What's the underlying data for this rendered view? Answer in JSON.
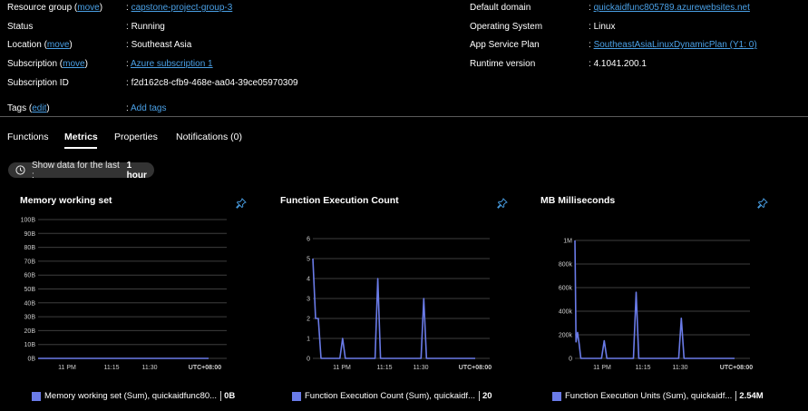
{
  "essentials": {
    "resource_group_label": "Resource group",
    "resource_group_edit": "move",
    "resource_group_value": "capstone-project-group-3",
    "status_label": "Status",
    "status_value": "Running",
    "location_label": "Location",
    "location_edit": "move",
    "location_value": "Southeast Asia",
    "subscription_label": "Subscription",
    "subscription_edit": "move",
    "subscription_value": "Azure subscription 1",
    "subscription_id_label": "Subscription ID",
    "subscription_id_value": "f2d162c8-cfb9-468e-aa04-39ce05970309",
    "tags_label": "Tags",
    "tags_edit": "edit",
    "tags_value": "Add tags",
    "default_domain_label": "Default domain",
    "default_domain_value": "quickaidfunc805789.azurewebsites.net",
    "os_label": "Operating System",
    "os_value": "Linux",
    "plan_label": "App Service Plan",
    "plan_value": "SoutheastAsiaLinuxDynamicPlan (Y1: 0)",
    "runtime_label": "Runtime version",
    "runtime_value": "4.1041.200.1"
  },
  "tabs": [
    {
      "label": "Functions"
    },
    {
      "label": "Metrics"
    },
    {
      "label": "Properties"
    },
    {
      "label": "Notifications (0)"
    }
  ],
  "time_range": {
    "prefix": "Show data for the last :",
    "value": "1 hour"
  },
  "icons": {
    "time": "clock-icon",
    "pin": "pin-icon"
  },
  "colors": {
    "accent": "#4aa0e6",
    "series": "#6a7be8"
  },
  "chart_data": [
    {
      "type": "line",
      "title": "Memory working set",
      "yticks": [
        "100B",
        "90B",
        "80B",
        "70B",
        "60B",
        "50B",
        "40B",
        "30B",
        "20B",
        "10B",
        "0B"
      ],
      "xticks": [
        "11 PM",
        "11:15",
        "11:30",
        "UTC+08:00"
      ],
      "ylim": [
        0,
        100
      ],
      "series": [
        {
          "name": "Memory working set (Sum), quickaidfunc80...",
          "x": [
            0,
            60
          ],
          "y": [
            0,
            0
          ]
        }
      ],
      "legend_value": "0B"
    },
    {
      "type": "line",
      "title": "Function Execution Count",
      "yticks": [
        "6",
        "5",
        "4",
        "3",
        "2",
        "1",
        "0"
      ],
      "xticks": [
        "11 PM",
        "11:15",
        "11:30",
        "UTC+08:00"
      ],
      "ylim": [
        0,
        6
      ],
      "series": [
        {
          "name": "Function Execution Count (Sum), quickaidf...",
          "x": [
            0,
            1,
            2,
            3,
            10,
            11,
            12,
            23,
            24,
            25,
            40,
            41,
            42,
            60
          ],
          "y": [
            5,
            2,
            2,
            0,
            0,
            1,
            0,
            0,
            4,
            0,
            0,
            3,
            0,
            0
          ]
        }
      ],
      "legend_value": "20"
    },
    {
      "type": "line",
      "title": "MB Milliseconds",
      "yticks": [
        "1M",
        "800k",
        "600k",
        "400k",
        "200k",
        "0"
      ],
      "xticks": [
        "11 PM",
        "11:15",
        "11:30",
        "UTC+08:00"
      ],
      "ylim": [
        0,
        1000000
      ],
      "series": [
        {
          "name": "Function Execution Units (Sum), quickaidf...",
          "x": [
            0,
            0.4,
            1,
            1.6,
            2.2,
            10,
            11,
            12,
            22,
            23,
            24,
            39,
            40,
            41,
            60
          ],
          "y": [
            1000000,
            140000,
            220000,
            120000,
            0,
            0,
            150000,
            0,
            0,
            560000,
            0,
            0,
            340000,
            0,
            0
          ]
        }
      ],
      "legend_value": "2.54M"
    }
  ]
}
